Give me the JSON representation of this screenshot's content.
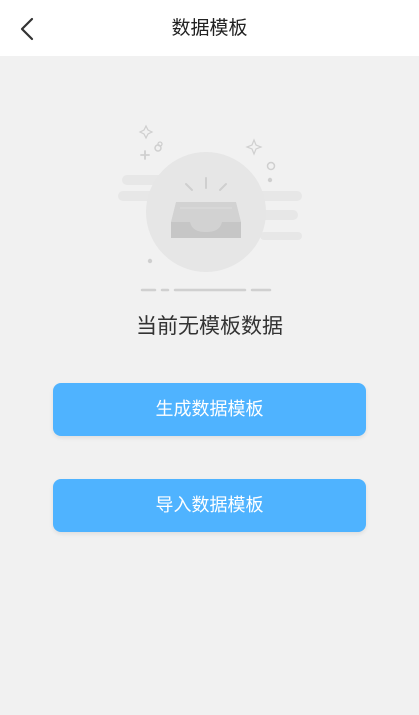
{
  "header": {
    "title": "数据模板",
    "back_icon": "chevron-left-icon"
  },
  "empty_state": {
    "text": "当前无模板数据",
    "icon": "empty-inbox-icon"
  },
  "actions": {
    "generate_label": "生成数据模板",
    "import_label": "导入数据模板"
  },
  "colors": {
    "header_bg": "#ffffff",
    "page_bg": "#f1f1f1",
    "button": "#4fb3ff",
    "button_text": "#ffffff"
  }
}
